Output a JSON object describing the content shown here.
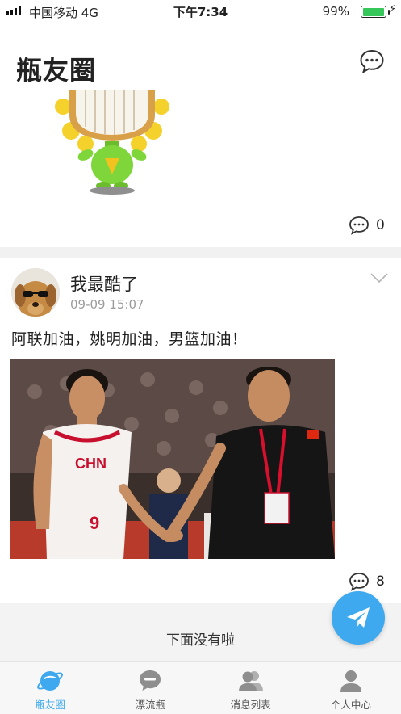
{
  "status_bar": {
    "carrier": "中国移动  4G",
    "time": "下午7:34",
    "battery_percent": "99%",
    "battery_level": 0.99,
    "battery_color": "#35c759"
  },
  "header": {
    "title": "瓶友圈",
    "action_icon": "chat-bubble-icon"
  },
  "feed": {
    "posts": [
      {
        "type": "sticker",
        "image": "sunflower-mirror-sticker",
        "comment_count": "0"
      },
      {
        "author": "我最酷了",
        "avatar": "dog-with-sunglasses-avatar",
        "timestamp": "09-09 15:07",
        "text": "阿联加油，姚明加油，男篮加油！",
        "image": "basketball-handshake-photo",
        "comment_count": "8"
      }
    ],
    "end_message": "下面没有啦"
  },
  "fab": {
    "icon": "send-paper-plane-icon",
    "color": "#3ea9ee"
  },
  "tab_bar": {
    "active_color": "#3ea9ee",
    "items": [
      {
        "label": "瓶友圈",
        "icon": "planet-icon",
        "active": true
      },
      {
        "label": "漂流瓶",
        "icon": "chat-bubble-icon",
        "active": false
      },
      {
        "label": "消息列表",
        "icon": "contacts-icon",
        "active": false
      },
      {
        "label": "个人中心",
        "icon": "person-icon",
        "active": false
      }
    ]
  }
}
